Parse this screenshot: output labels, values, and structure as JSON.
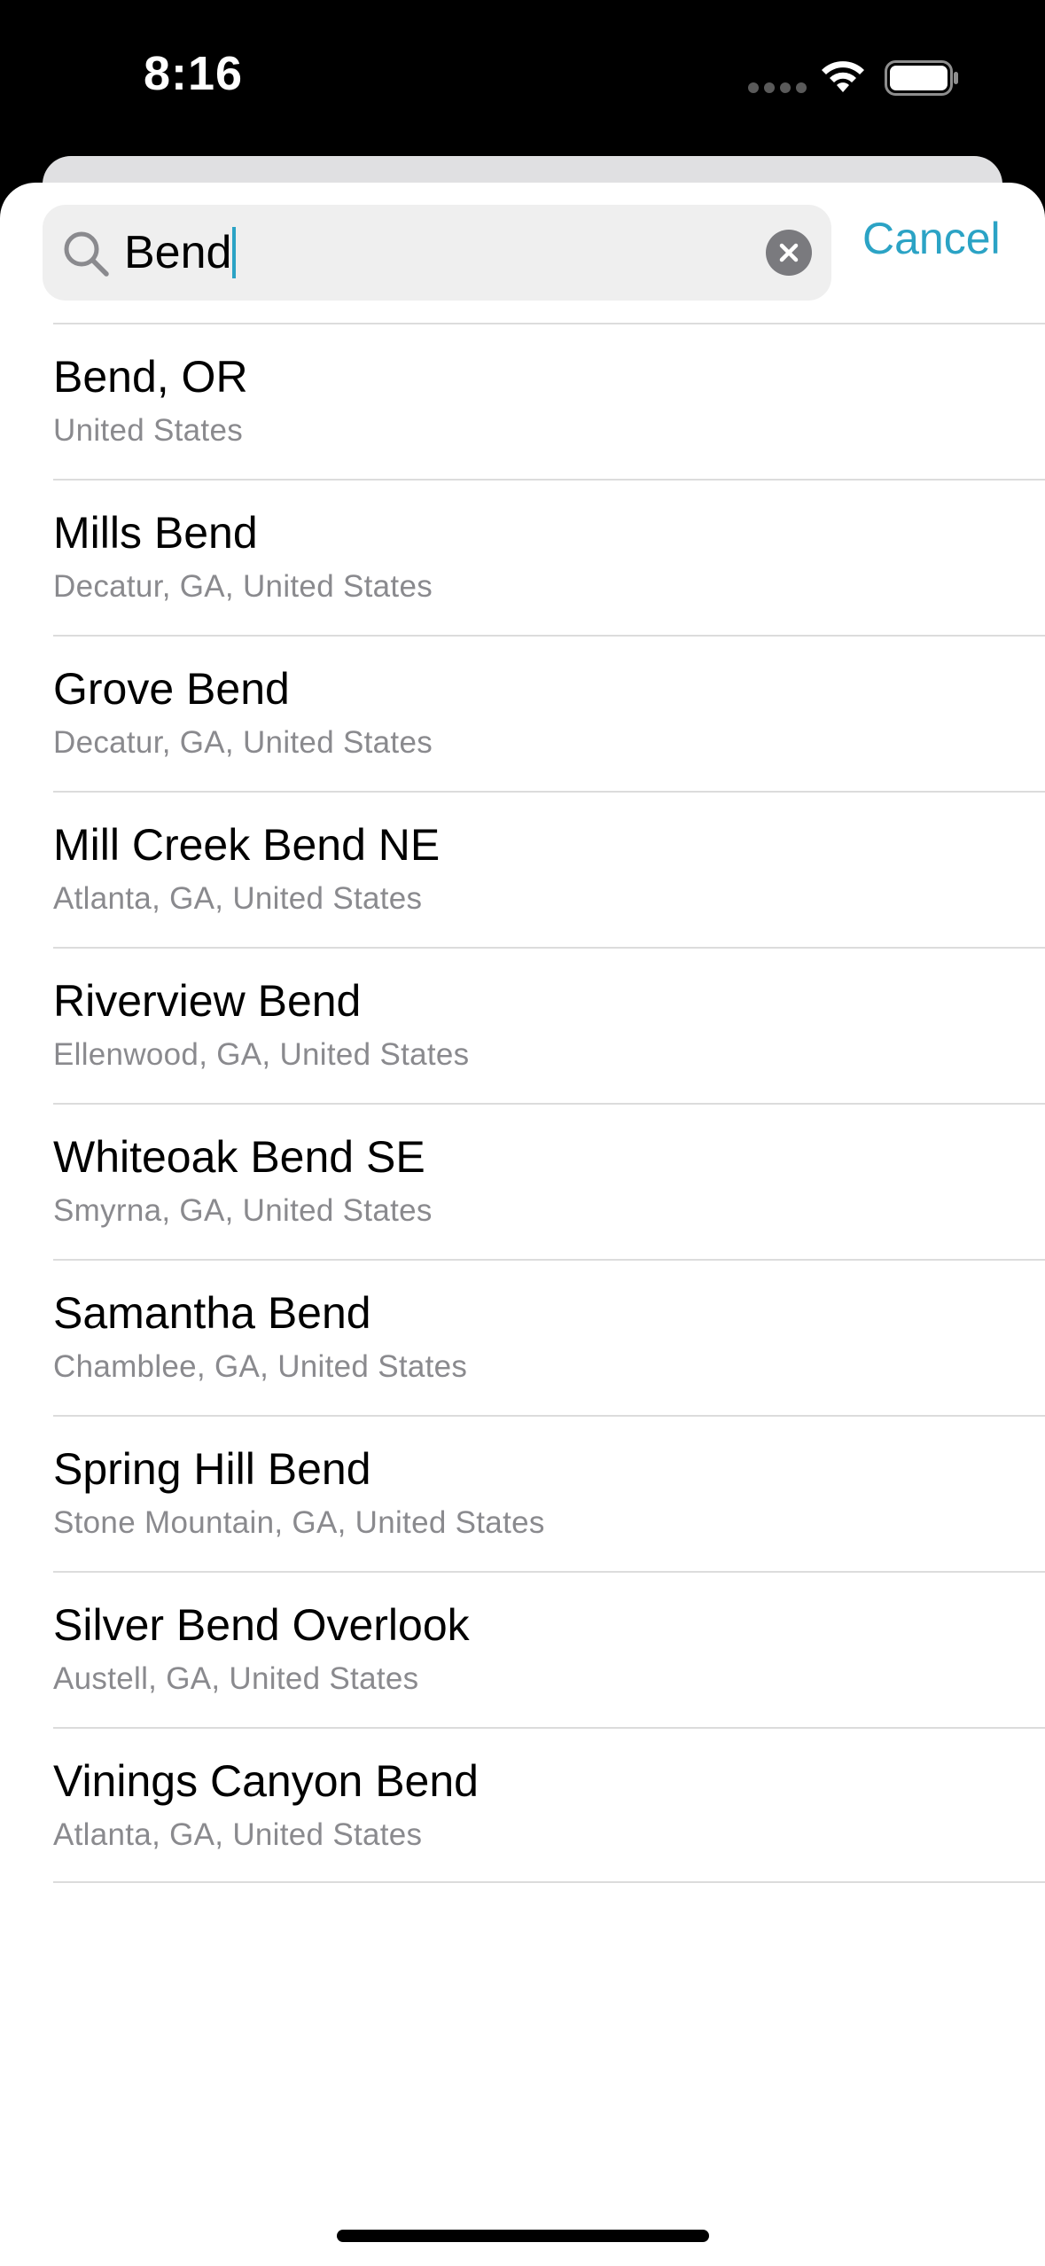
{
  "status_bar": {
    "time": "8:16",
    "icons": [
      "cellular-dots-icon",
      "wifi-icon",
      "battery-icon"
    ]
  },
  "search": {
    "value": "Bend",
    "icon": "search-icon",
    "clear_icon": "clear-icon",
    "cancel_label": "Cancel"
  },
  "colors": {
    "accent": "#2ba3c5",
    "field_background": "#efefef",
    "subtitle": "#8a8a8e",
    "separator": "#dcdcdc"
  },
  "results": [
    {
      "title": "Bend, OR",
      "subtitle": "United States"
    },
    {
      "title": "Mills Bend",
      "subtitle": "Decatur, GA, United States"
    },
    {
      "title": "Grove Bend",
      "subtitle": "Decatur, GA, United States"
    },
    {
      "title": "Mill Creek Bend NE",
      "subtitle": "Atlanta, GA, United States"
    },
    {
      "title": "Riverview Bend",
      "subtitle": "Ellenwood, GA, United States"
    },
    {
      "title": "Whiteoak Bend SE",
      "subtitle": "Smyrna, GA, United States"
    },
    {
      "title": "Samantha Bend",
      "subtitle": "Chamblee, GA, United States"
    },
    {
      "title": "Spring Hill Bend",
      "subtitle": "Stone Mountain, GA, United States"
    },
    {
      "title": "Silver Bend Overlook",
      "subtitle": "Austell, GA, United States"
    },
    {
      "title": "Vinings Canyon Bend",
      "subtitle": "Atlanta, GA, United States"
    }
  ]
}
